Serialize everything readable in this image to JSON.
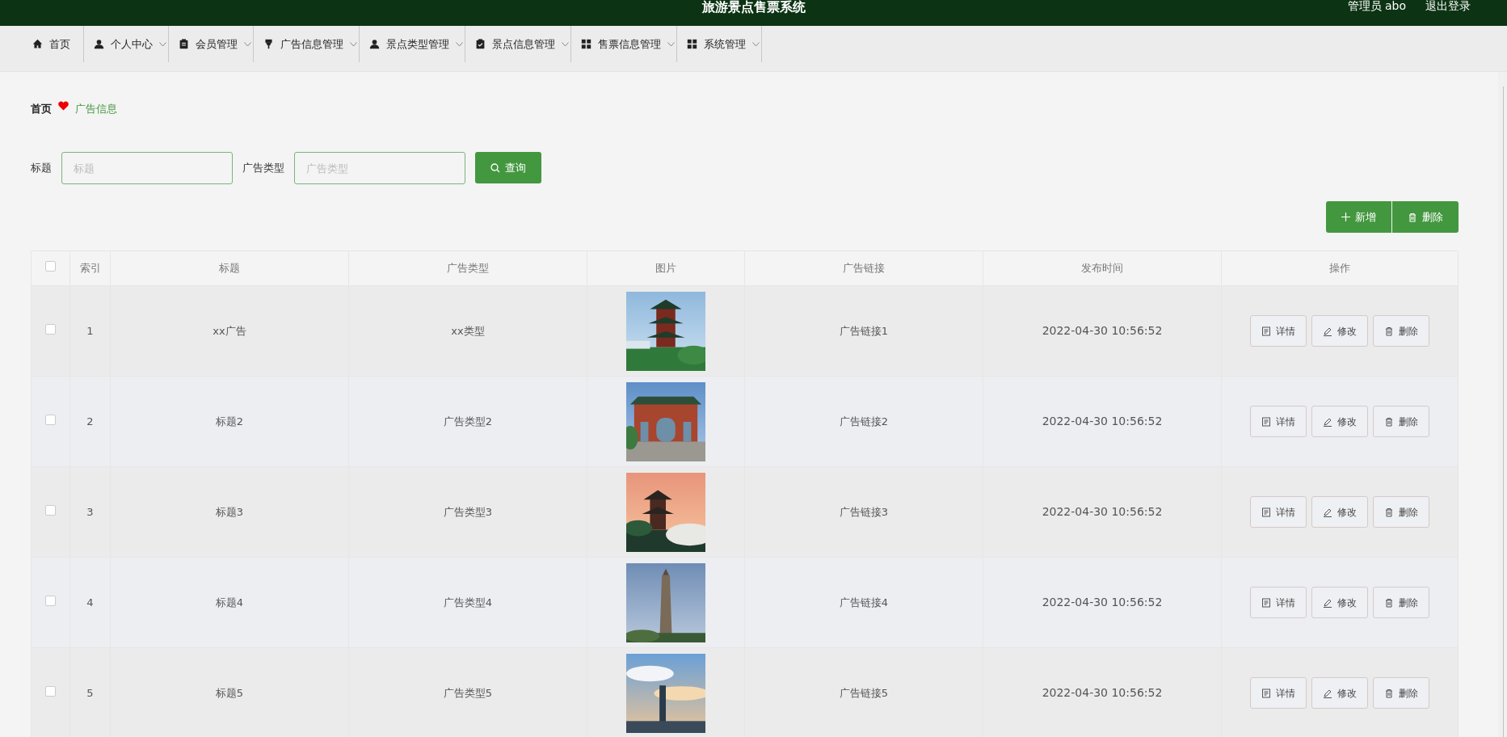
{
  "header": {
    "title": "旅游景点售票系统",
    "user": "管理员 abo",
    "logout": "退出登录"
  },
  "nav": [
    {
      "label": "首页",
      "dropdown": false
    },
    {
      "label": "个人中心",
      "dropdown": true
    },
    {
      "label": "会员管理",
      "dropdown": true
    },
    {
      "label": "广告信息管理",
      "dropdown": true
    },
    {
      "label": "景点类型管理",
      "dropdown": true
    },
    {
      "label": "景点信息管理",
      "dropdown": true
    },
    {
      "label": "售票信息管理",
      "dropdown": true
    },
    {
      "label": "系统管理",
      "dropdown": true
    }
  ],
  "breadcrumb": [
    "首页",
    "广告信息"
  ],
  "search": {
    "fields": [
      {
        "label": "标题",
        "placeholder": "标题"
      },
      {
        "label": "广告类型",
        "placeholder": "广告类型"
      }
    ],
    "button": "查询"
  },
  "actions": {
    "add": "新增",
    "delete": "删除"
  },
  "table": {
    "select_all": {
      "checked": false
    },
    "columns": [
      "索引",
      "标题",
      "广告类型",
      "图片",
      "广告链接",
      "发布时间",
      "操作"
    ],
    "rows": [
      {
        "checked": false,
        "index": "1",
        "title": "xx广告",
        "type": "xx类型",
        "link": "广告链接1",
        "time": "2022-04-30 10:56:52",
        "buttons": [
          "详情",
          "修改",
          "删除"
        ]
      },
      {
        "checked": false,
        "index": "2",
        "title": "标题2",
        "type": "广告类型2",
        "link": "广告链接2",
        "time": "2022-04-30 10:56:52",
        "buttons": [
          "详情",
          "修改",
          "删除"
        ]
      },
      {
        "checked": false,
        "index": "3",
        "title": "标题3",
        "type": "广告类型3",
        "link": "广告链接3",
        "time": "2022-04-30 10:56:52",
        "buttons": [
          "详情",
          "修改",
          "删除"
        ]
      },
      {
        "checked": false,
        "index": "4",
        "title": "标题4",
        "type": "广告类型4",
        "link": "广告链接4",
        "time": "2022-04-30 10:56:52",
        "buttons": [
          "详情",
          "修改",
          "删除"
        ]
      },
      {
        "checked": false,
        "index": "5",
        "title": "标题5",
        "type": "广告类型5",
        "link": "广告链接5",
        "time": "2022-04-30 10:56:52",
        "buttons": [
          "详情",
          "修改",
          "删除"
        ]
      }
    ]
  }
}
